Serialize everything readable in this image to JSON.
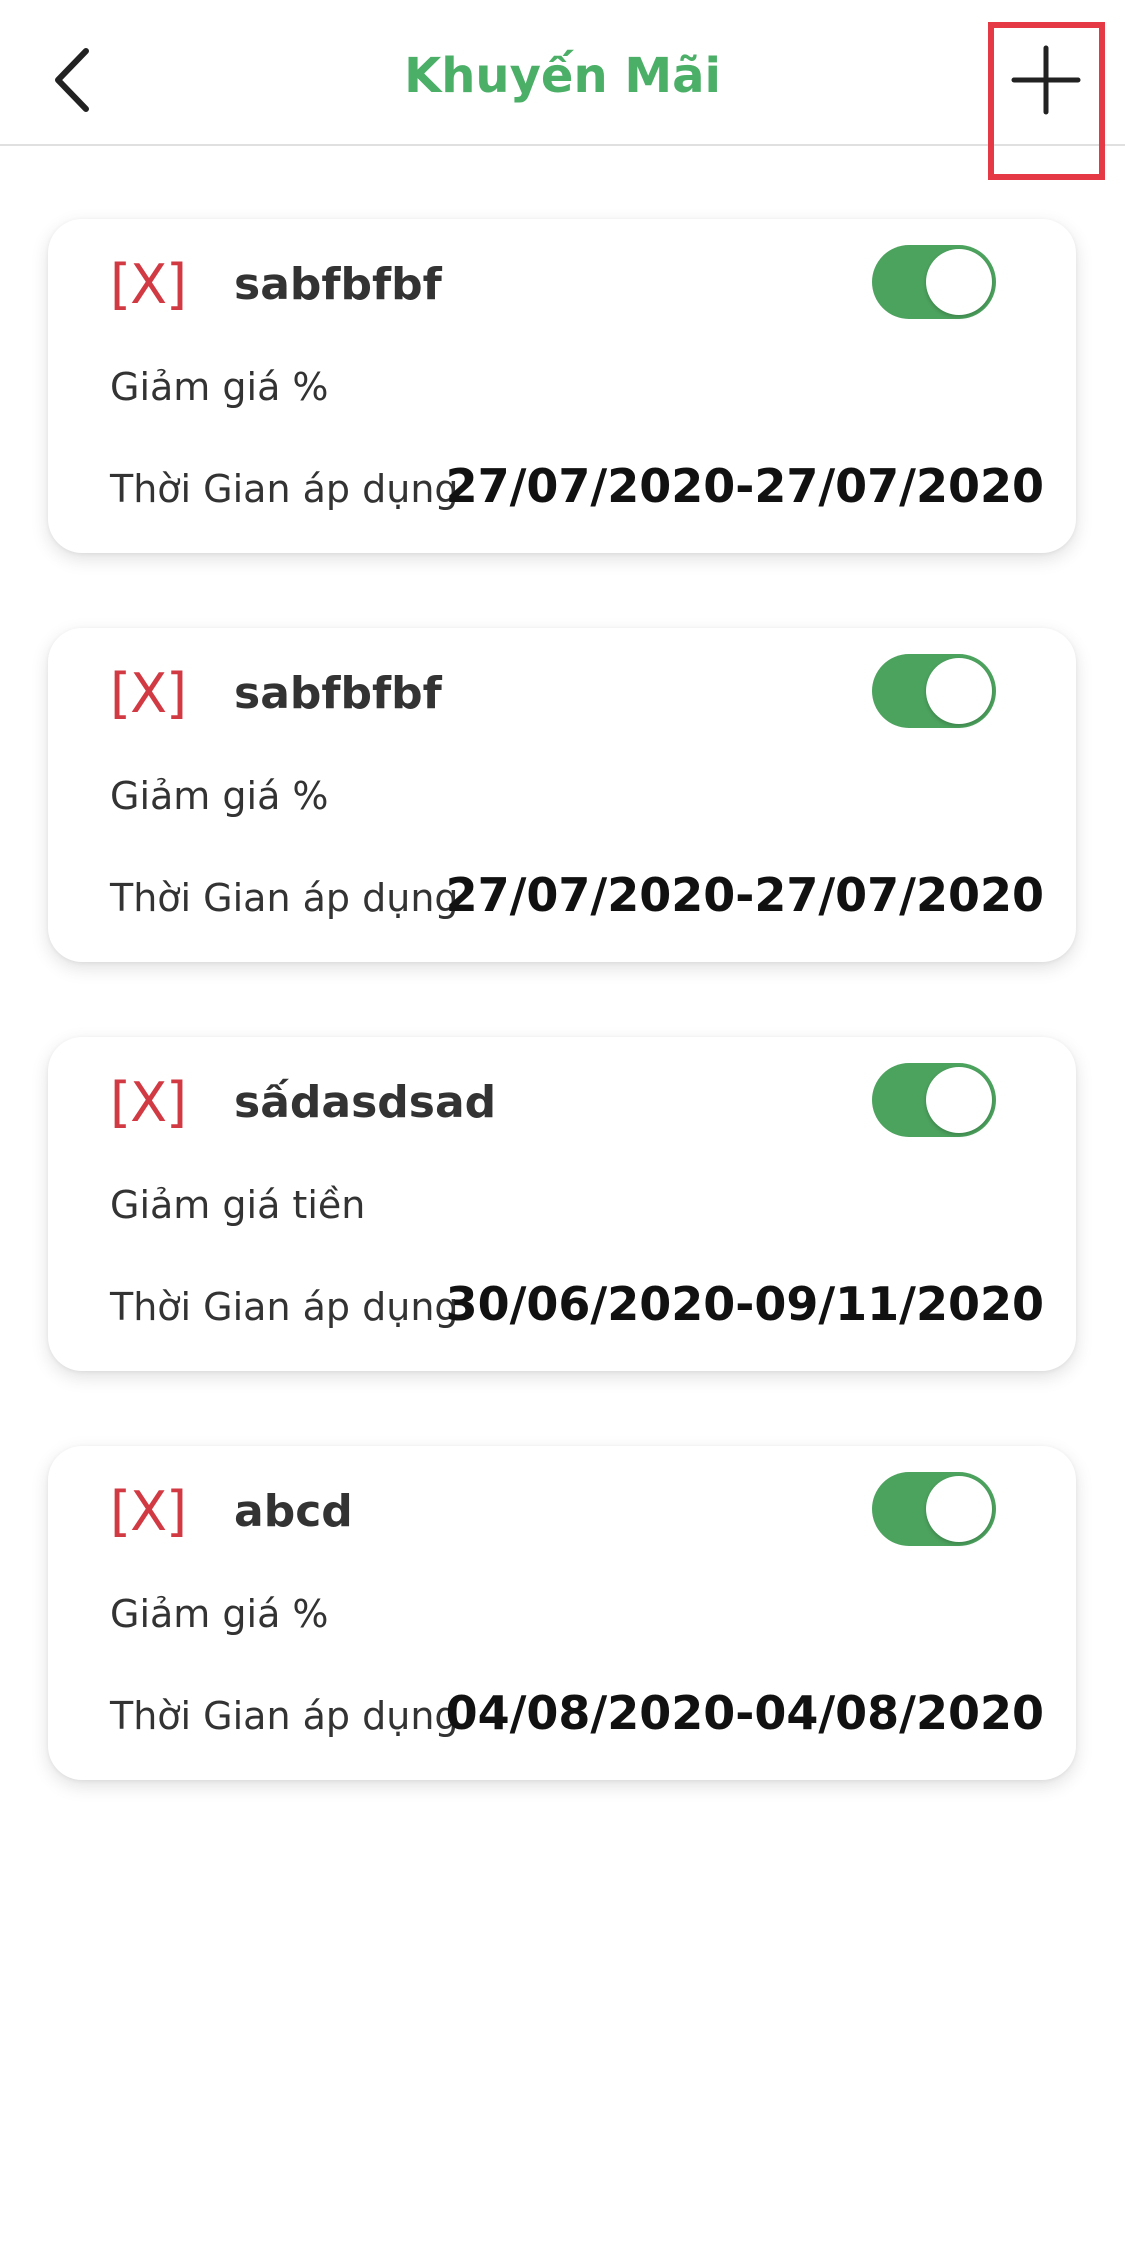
{
  "header": {
    "title": "Khuyến Mãi",
    "back_icon": "chevron-left-icon",
    "add_icon": "plus-icon"
  },
  "colors": {
    "accent_green": "#4CAF68",
    "toggle_green": "#4CA35E",
    "delete_red": "#d23a43",
    "highlight_red": "#e53945"
  },
  "promotions": [
    {
      "delete_label": "[X]",
      "name": "sabfbfbf",
      "type": "Giảm giá %",
      "period_label": "Thời Gian áp dụng",
      "period": "27/07/2020-27/07/2020",
      "enabled": true
    },
    {
      "delete_label": "[X]",
      "name": "sabfbfbf",
      "type": "Giảm giá %",
      "period_label": "Thời Gian áp dụng",
      "period": "27/07/2020-27/07/2020",
      "enabled": true
    },
    {
      "delete_label": "[X]",
      "name": "sấdasdsad",
      "type": "Giảm giá tiền",
      "period_label": "Thời Gian áp dụng",
      "period": "30/06/2020-09/11/2020",
      "enabled": true
    },
    {
      "delete_label": "[X]",
      "name": "abcd",
      "type": "Giảm giá %",
      "period_label": "Thời Gian áp dụng",
      "period": "04/08/2020-04/08/2020",
      "enabled": true
    }
  ]
}
